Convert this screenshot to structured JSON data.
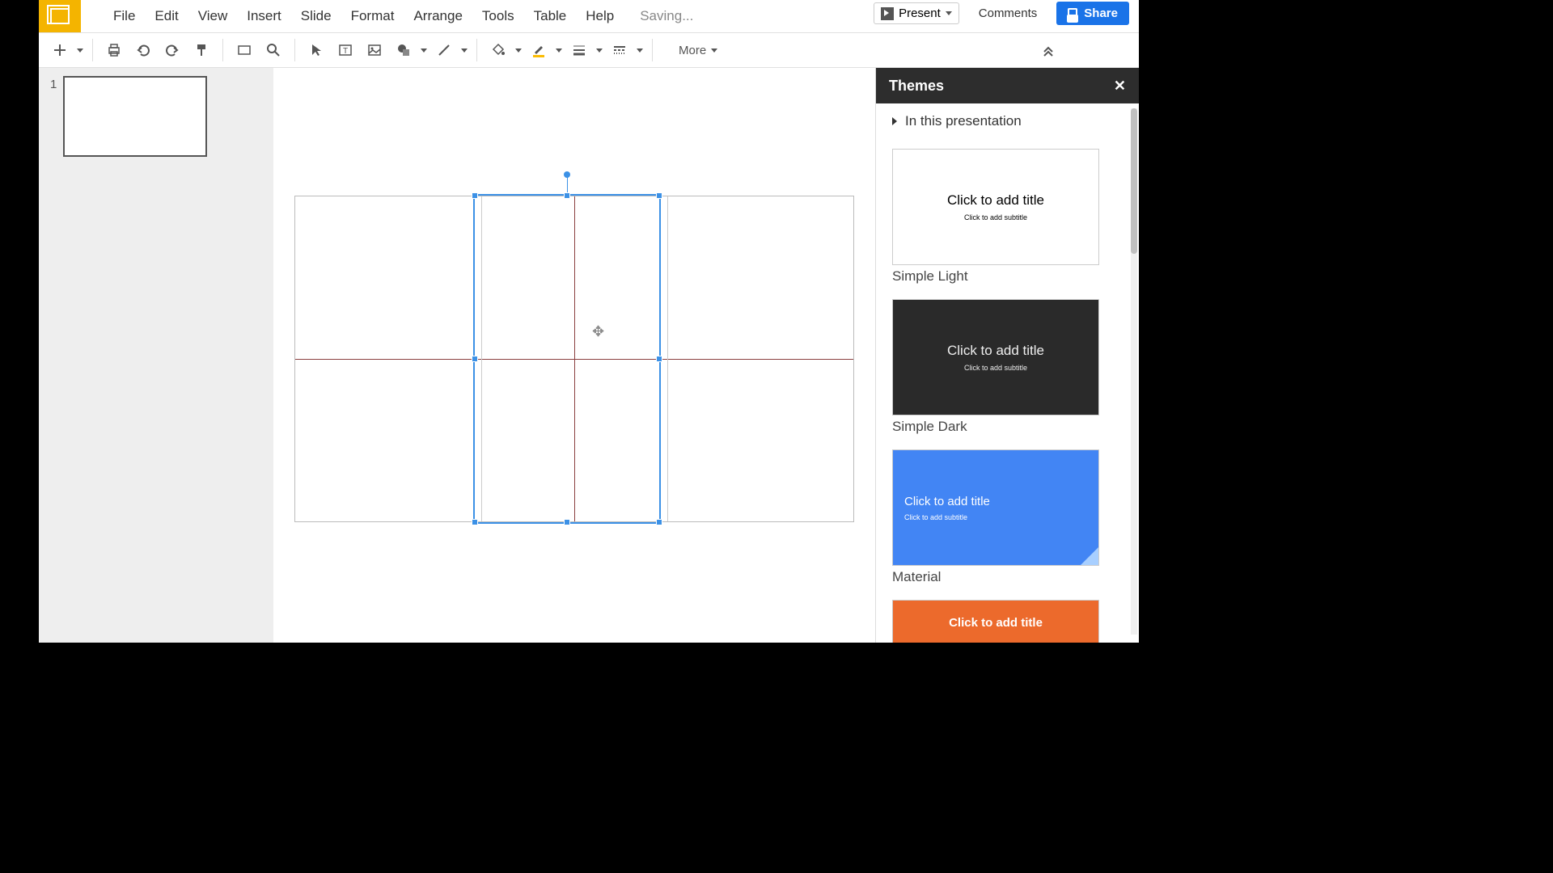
{
  "menubar": {
    "items": [
      "File",
      "Edit",
      "View",
      "Insert",
      "Slide",
      "Format",
      "Arrange",
      "Tools",
      "Table",
      "Help"
    ],
    "status": "Saving..."
  },
  "header_actions": {
    "present": "Present",
    "comments": "Comments",
    "share": "Share"
  },
  "toolbar": {
    "more": "More"
  },
  "slides": {
    "items": [
      {
        "number": "1"
      }
    ]
  },
  "themes_panel": {
    "title": "Themes",
    "section": "In this presentation",
    "themes": [
      {
        "name": "Simple Light",
        "title": "Click to add title",
        "subtitle": "Click to add subtitle",
        "style": "light"
      },
      {
        "name": "Simple Dark",
        "title": "Click to add title",
        "subtitle": "Click to add subtitle",
        "style": "dark"
      },
      {
        "name": "Material",
        "title": "Click to add title",
        "subtitle": "Click to add subtitle",
        "style": "material"
      },
      {
        "name": "",
        "title": "Click to add title",
        "subtitle": "",
        "style": "orange"
      }
    ]
  },
  "colors": {
    "accent": "#1a73e8",
    "logo": "#f4b400",
    "selection": "#3c91e6"
  }
}
